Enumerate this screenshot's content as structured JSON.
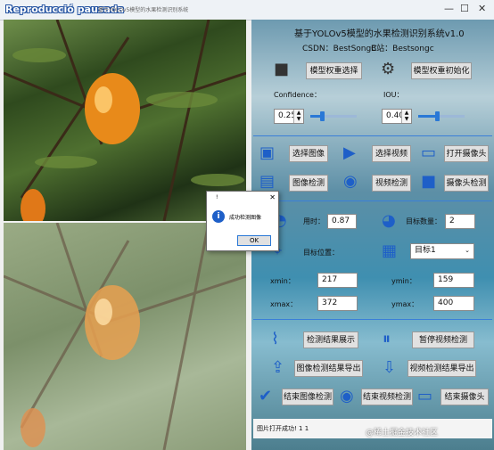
{
  "window": {
    "overlay_label": "Reproducció pausada",
    "title": "基于YOLOv5模型的水果检测识别系统",
    "minimize_glyph": "—",
    "maximize_glyph": "☐",
    "close_glyph": "✕"
  },
  "header": {
    "title": "基于YOLOv5模型的水果检测识别系统v1.0",
    "csdn": "CSDN：BestSongC",
    "bili": "B站：Bestsongc"
  },
  "model": {
    "select_label": "模型权重选择",
    "init_label": "模型权重初始化",
    "confidence_label": "Confidence：",
    "confidence_value": "0.25",
    "iou_label": "IOU：",
    "iou_value": "0.40",
    "confidence_level": 0.25,
    "iou_level": 0.4
  },
  "actions": {
    "select_image": "选择图像",
    "select_video": "选择视频",
    "open_camera": "打开摄像头",
    "image_detect": "图像检测",
    "video_detect": "视频检测",
    "camera_detect": "摄像头检测"
  },
  "results": {
    "time_label": "用时：",
    "time_value": "0.87",
    "count_label": "目标数量：",
    "count_value": "2",
    "position_label": "目标位置：",
    "target_select": "目标1",
    "xmin_label": "xmin：",
    "xmin_value": "217",
    "ymin_label": "ymin：",
    "ymin_value": "159",
    "xmax_label": "xmax：",
    "xmax_value": "372",
    "ymax_label": "ymax：",
    "ymax_value": "400"
  },
  "controls": {
    "show_results": "检测结果展示",
    "pause_video": "暂停视频检测",
    "export_image": "图像检测结果导出",
    "export_video": "视频检测结果导出",
    "end_image": "结束图像检测",
    "end_video": "结束视频检测",
    "end_camera": "结束摄像头"
  },
  "status_text": "图片打开成功! 1 1",
  "watermark": "@稀土掘金技术社区",
  "dialog": {
    "title": "!",
    "close": "✕",
    "message": "成功检测图像",
    "ok": "OK"
  },
  "colors": {
    "accent": "#2a78d6",
    "button_bg": "#e1e1e1",
    "orange": "#e88a1a"
  }
}
